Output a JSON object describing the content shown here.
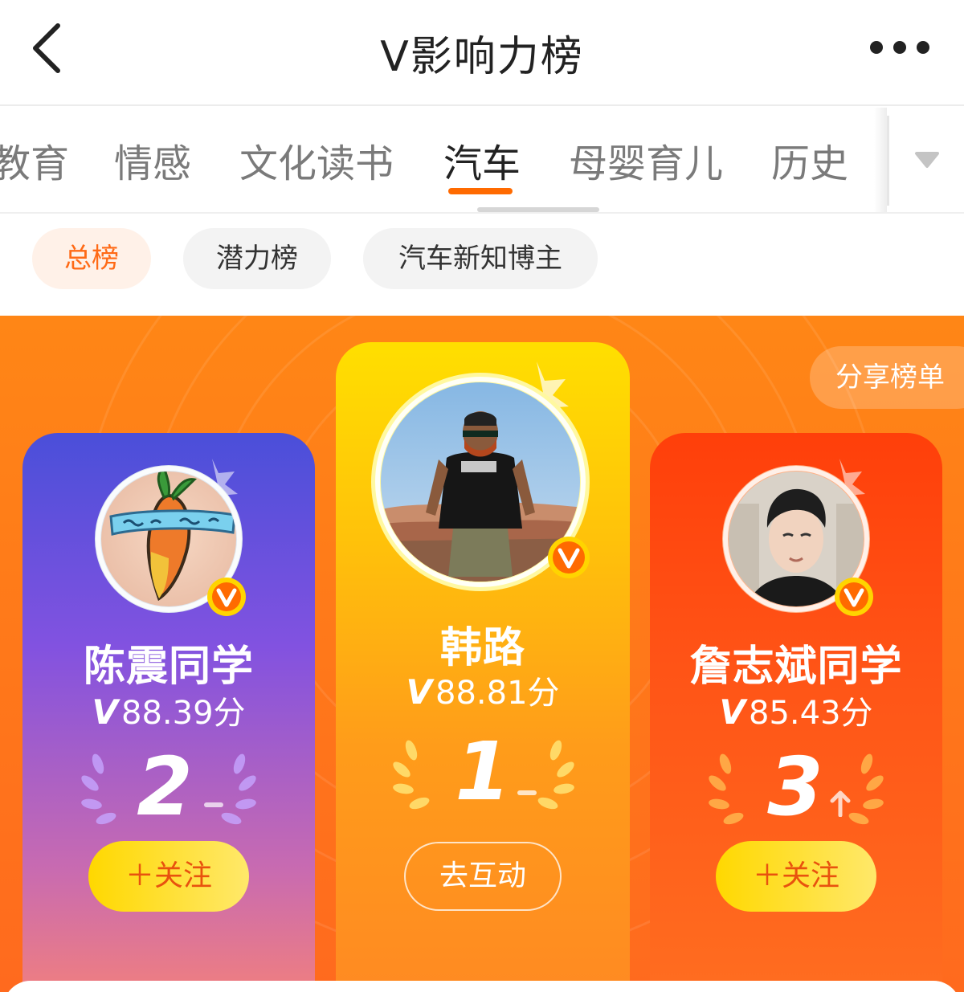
{
  "header": {
    "title": "V影响力榜",
    "back_icon": "chevron-left-icon",
    "more_icon": "more-dots-icon"
  },
  "category_tabs": {
    "items": [
      {
        "label": "教育",
        "active": false
      },
      {
        "label": "情感",
        "active": false
      },
      {
        "label": "文化读书",
        "active": false
      },
      {
        "label": "汽车",
        "active": true
      },
      {
        "label": "母婴育儿",
        "active": false
      },
      {
        "label": "历史",
        "active": false
      }
    ],
    "dropdown_icon": "triangle-down-icon",
    "accent_color": "#ff6a00"
  },
  "sub_tabs": {
    "items": [
      {
        "label": "总榜",
        "active": true
      },
      {
        "label": "潜力榜",
        "active": false
      },
      {
        "label": "汽车新知博主",
        "active": false
      }
    ]
  },
  "board": {
    "share_label": "分享榜单",
    "background_color": "#ff7a1a",
    "ranking": [
      {
        "rank": "1",
        "name": "韩路",
        "score_prefix": "V",
        "score": "88.81分",
        "trend": "none",
        "button_label": "去互动",
        "verified_icon": "verified-v-badge-icon"
      },
      {
        "rank": "2",
        "name": "陈震同学",
        "score_prefix": "V",
        "score": "88.39分",
        "trend": "none",
        "button_label": "＋关注",
        "verified_icon": "verified-v-badge-icon"
      },
      {
        "rank": "3",
        "name": "詹志斌同学",
        "score_prefix": "V",
        "score": "85.43分",
        "trend": "up",
        "button_label": "＋关注",
        "verified_icon": "verified-v-badge-icon"
      }
    ]
  }
}
